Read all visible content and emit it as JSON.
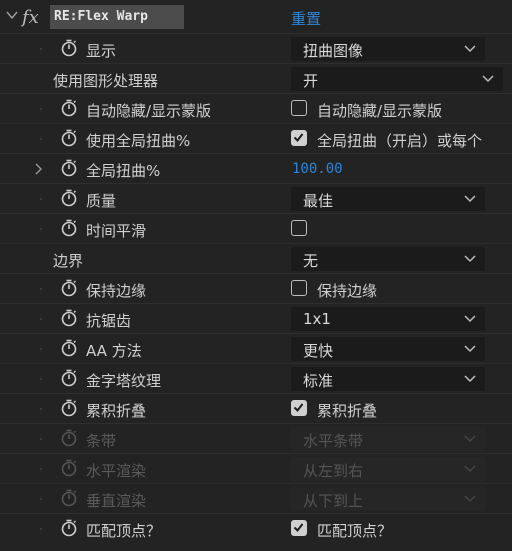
{
  "effect": {
    "name": "RE:Flex Warp",
    "reset_label": "重置"
  },
  "rows": [
    {
      "label": "显示",
      "dropdown": "扭曲图像"
    },
    {
      "label": "使用图形处理器",
      "dropdown": "开"
    },
    {
      "label": "自动隐藏/显示蒙版",
      "checkbox_label": "自动隐藏/显示蒙版",
      "checked": false
    },
    {
      "label": "使用全局扭曲%",
      "checkbox_label": "全局扭曲（开启）或每个",
      "checked": true
    },
    {
      "label": "全局扭曲%",
      "value": "100.00"
    },
    {
      "label": "质量",
      "dropdown": "最佳"
    },
    {
      "label": "时间平滑",
      "checked": false
    },
    {
      "label": "边界",
      "dropdown": "无"
    },
    {
      "label": "保持边缘",
      "checkbox_label": "保持边缘",
      "checked": false
    },
    {
      "label": "抗锯齿",
      "dropdown": "1x1"
    },
    {
      "label": "AA 方法",
      "dropdown": "更快"
    },
    {
      "label": "金字塔纹理",
      "dropdown": "标准"
    },
    {
      "label": "累积折叠",
      "checkbox_label": "累积折叠",
      "checked": true
    },
    {
      "label": "条带",
      "dropdown": "水平条带",
      "disabled": true
    },
    {
      "label": "水平渲染",
      "dropdown": "从左到右",
      "disabled": true
    },
    {
      "label": "垂直渲染",
      "dropdown": "从下到上",
      "disabled": true
    },
    {
      "label": "匹配顶点？",
      "checkbox_label": "匹配顶点？",
      "checked": true
    }
  ],
  "colors": {
    "accent": "#2b86d8",
    "panel_bg": "#232323",
    "field_bg": "#1b1b1b"
  }
}
